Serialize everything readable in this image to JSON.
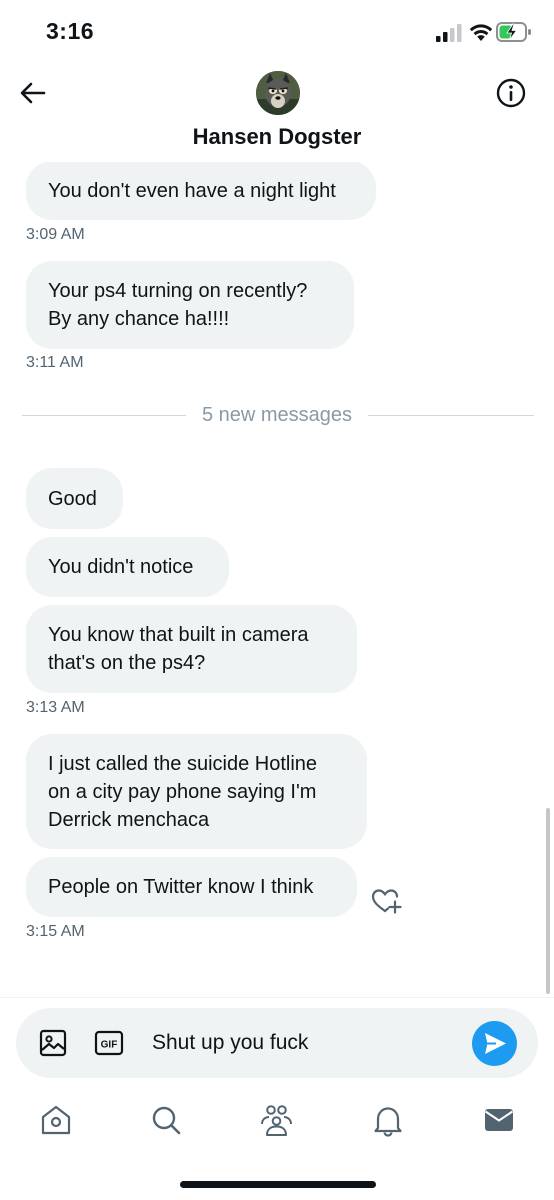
{
  "status_bar": {
    "time": "3:16"
  },
  "header": {
    "chat_name": "Hansen Dogster",
    "icons": [
      "back-arrow-icon",
      "info-icon"
    ]
  },
  "messages": {
    "m1": {
      "text": "You don't even have a night light"
    },
    "t1": "3:09 AM",
    "m2": {
      "line1": "Your ps4 turning on recently?",
      "line2": "By any chance ha!!!!"
    },
    "t2": "3:11 AM",
    "divider": "5 new messages",
    "m3": {
      "text": "Good"
    },
    "m4": {
      "text": "You didn't notice"
    },
    "m5": {
      "line1": "You know that built in camera",
      "line2": "that's on the ps4?"
    },
    "t3": "3:13 AM",
    "m6": {
      "line1": "I just called the suicide Hotline",
      "line2": "on a city pay phone saying I'm",
      "line3": "Derrick menchaca"
    },
    "m7": {
      "text": "People on Twitter know I think"
    },
    "t4": "3:15 AM"
  },
  "composer": {
    "value": "Shut up you fuck",
    "gif_label": "GIF"
  },
  "tabs": [
    "home-icon",
    "search-icon",
    "communities-icon",
    "notifications-icon",
    "messages-icon"
  ],
  "colors": {
    "accent": "#1d9bf0",
    "bubble": "#eff3f4",
    "secondary_text": "#536471"
  }
}
